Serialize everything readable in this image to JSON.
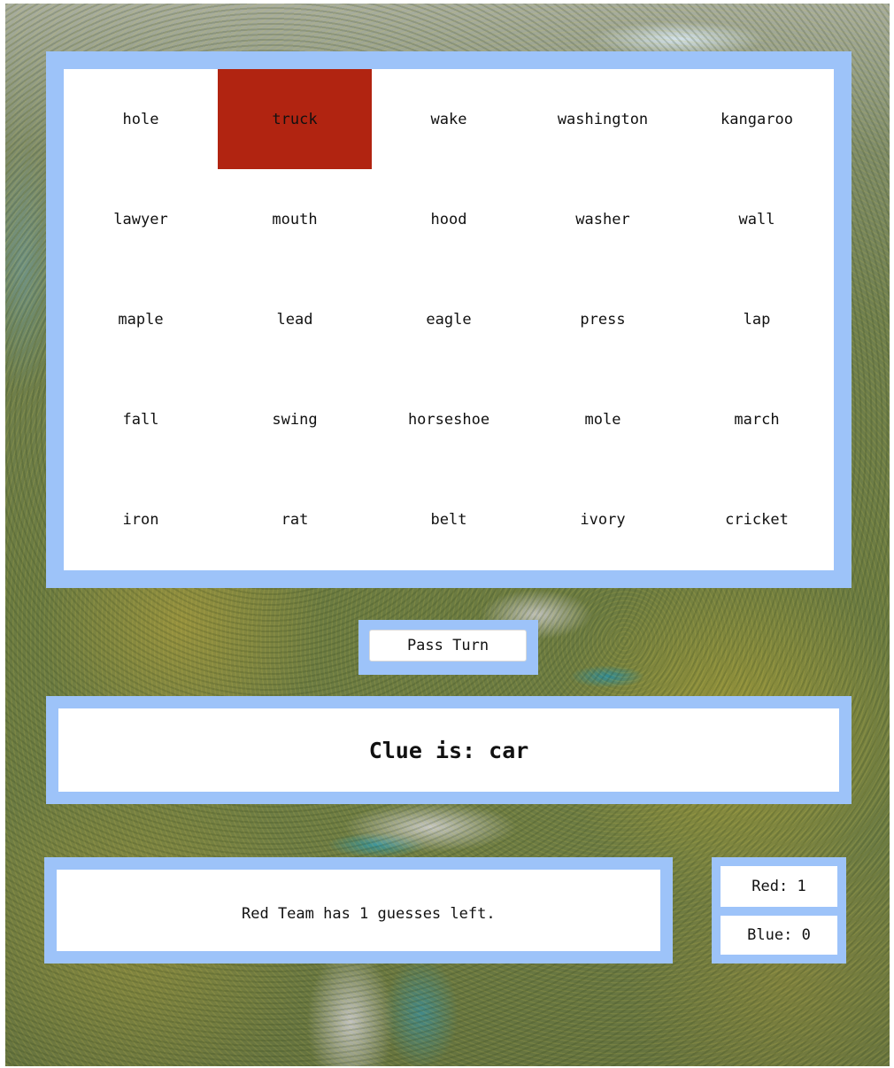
{
  "board": {
    "cards": [
      {
        "word": "hole",
        "state": "hidden"
      },
      {
        "word": "truck",
        "state": "red"
      },
      {
        "word": "wake",
        "state": "hidden"
      },
      {
        "word": "washington",
        "state": "hidden"
      },
      {
        "word": "kangaroo",
        "state": "hidden"
      },
      {
        "word": "lawyer",
        "state": "hidden"
      },
      {
        "word": "mouth",
        "state": "hidden"
      },
      {
        "word": "hood",
        "state": "hidden"
      },
      {
        "word": "washer",
        "state": "hidden"
      },
      {
        "word": "wall",
        "state": "hidden"
      },
      {
        "word": "maple",
        "state": "hidden"
      },
      {
        "word": "lead",
        "state": "hidden"
      },
      {
        "word": "eagle",
        "state": "hidden"
      },
      {
        "word": "press",
        "state": "hidden"
      },
      {
        "word": "lap",
        "state": "hidden"
      },
      {
        "word": "fall",
        "state": "hidden"
      },
      {
        "word": "swing",
        "state": "hidden"
      },
      {
        "word": "horseshoe",
        "state": "hidden"
      },
      {
        "word": "mole",
        "state": "hidden"
      },
      {
        "word": "march",
        "state": "hidden"
      },
      {
        "word": "iron",
        "state": "hidden"
      },
      {
        "word": "rat",
        "state": "hidden"
      },
      {
        "word": "belt",
        "state": "hidden"
      },
      {
        "word": "ivory",
        "state": "hidden"
      },
      {
        "word": "cricket",
        "state": "hidden"
      }
    ]
  },
  "controls": {
    "pass_label": "Pass Turn"
  },
  "clue": {
    "text": "Clue is: car"
  },
  "status": {
    "text": "Red Team has 1 guesses left."
  },
  "score": {
    "red": "Red: 1",
    "blue": "Blue: 0"
  },
  "colors": {
    "panel": "#9dc3f9",
    "red_card": "#b12411",
    "card": "#ffffff"
  }
}
